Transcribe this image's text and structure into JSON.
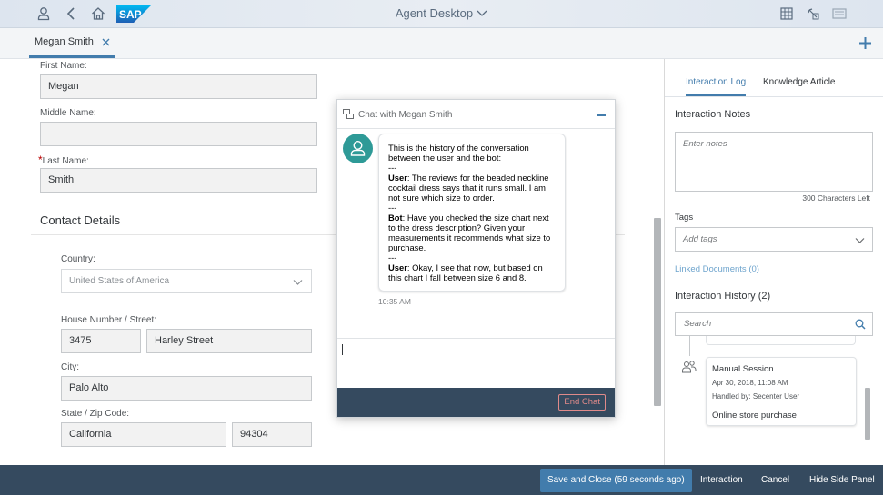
{
  "shell": {
    "title": "Agent Desktop",
    "logo_text": "SAP",
    "icons": [
      "person-icon",
      "back-icon",
      "home-icon",
      "grid-icon",
      "notes-icon",
      "keyboard-icon"
    ]
  },
  "tabs": [
    {
      "label": "Megan Smith"
    }
  ],
  "form": {
    "first_name_label": "First Name:",
    "first_name_value": "Megan",
    "middle_name_label": "Middle Name:",
    "middle_name_value": "",
    "last_name_required": "*",
    "last_name_label": "Last Name:",
    "last_name_value": "Smith",
    "contact_title": "Contact Details",
    "country_label": "Country:",
    "country_value": "United States of America",
    "street_label": "House Number / Street:",
    "house_number": "3475",
    "street": "Harley Street",
    "city_label": "City:",
    "city_value": "Palo Alto",
    "state_zip_label": "State / Zip Code:",
    "state_value": "California",
    "zip_value": "94304"
  },
  "chat": {
    "title": "Chat with Megan Smith",
    "intro": "This is the history of the conversation between the user and the bot:",
    "sep": "---",
    "user_label": "User",
    "user_msg1": ": The reviews for the beaded neckline cocktail dress says that it runs small. I am not sure which size to order.",
    "bot_label": "Bot",
    "bot_msg": ": Have you checked the size chart next to the dress description? Given your measurements it recommends what size to purchase.",
    "user_msg2": ": Okay, I see that now, but based on this chart I fall between size 6 and 8.",
    "time": "10:35 AM",
    "end_button": "End Chat"
  },
  "side": {
    "tabs": [
      "Interaction Log",
      "Knowledge Article"
    ],
    "notes_title": "Interaction Notes",
    "notes_placeholder": "Enter notes",
    "chars_left": "300 Characters Left",
    "tags_label": "Tags",
    "tags_placeholder": "Add tags",
    "linked_docs": "Linked Documents (0)",
    "history_title": "Interaction History (2)",
    "search_placeholder": "Search",
    "history_item": {
      "title": "Manual Session",
      "date": "Apr 30, 2018, 11:08 AM",
      "handled": "Handled by: Secenter User",
      "desc": "Online store purchase"
    }
  },
  "footer": {
    "save_close": "Save and Close (59 seconds ago)",
    "interaction": "Interaction",
    "cancel": "Cancel",
    "hide_panel": "Hide Side Panel"
  },
  "colors": {
    "accent": "#427cac",
    "footer_bg": "#354a5f",
    "avatar": "#2e9a97",
    "end_chat": "#e08a8a"
  }
}
